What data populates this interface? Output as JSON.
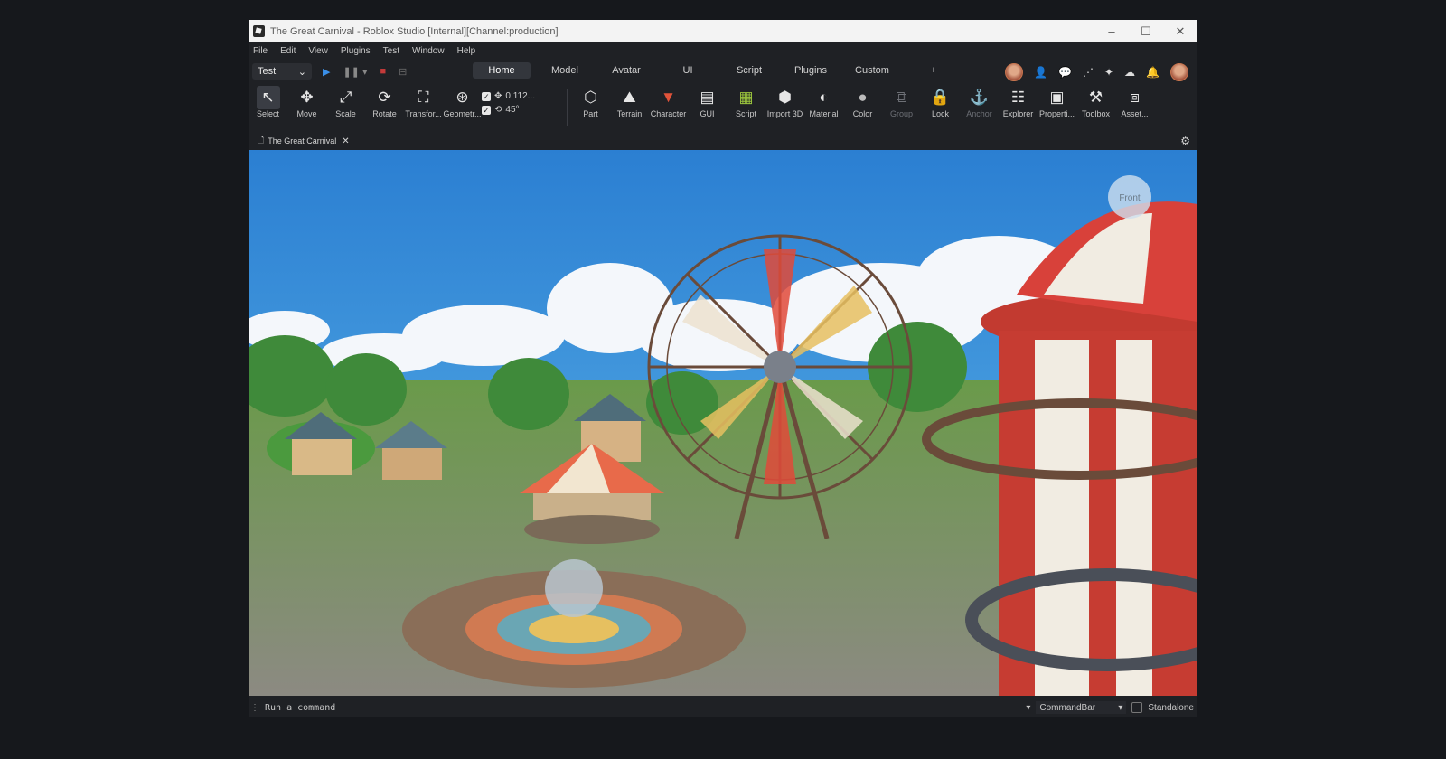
{
  "window": {
    "title": "The Great Carnival - Roblox Studio [Internal][Channel:production]"
  },
  "menu": [
    "File",
    "Edit",
    "View",
    "Plugins",
    "Test",
    "Window",
    "Help"
  ],
  "mode_select": {
    "value": "Test"
  },
  "tabs": [
    "Home",
    "Model",
    "Avatar",
    "UI",
    "Script",
    "Plugins",
    "Custom"
  ],
  "tabs_add": "+",
  "tools_left": [
    {
      "label": "Select",
      "icon": "select-icon"
    },
    {
      "label": "Move",
      "icon": "move-icon"
    },
    {
      "label": "Scale",
      "icon": "scale-icon"
    },
    {
      "label": "Rotate",
      "icon": "rotate-icon"
    },
    {
      "label": "Transfor...",
      "icon": "transform-icon"
    },
    {
      "label": "Geometr...",
      "icon": "geometry-icon"
    }
  ],
  "snap": {
    "move_value": "0.112...",
    "rotate_value": "45°"
  },
  "tools_right": [
    {
      "label": "Part",
      "icon": "part-icon"
    },
    {
      "label": "Terrain",
      "icon": "terrain-icon"
    },
    {
      "label": "Character",
      "icon": "character-icon"
    },
    {
      "label": "GUI",
      "icon": "gui-icon"
    },
    {
      "label": "Script",
      "icon": "script-icon"
    },
    {
      "label": "Import 3D",
      "icon": "import3d-icon"
    },
    {
      "label": "Material",
      "icon": "material-icon"
    },
    {
      "label": "Color",
      "icon": "color-icon"
    },
    {
      "label": "Group",
      "icon": "group-icon"
    },
    {
      "label": "Lock",
      "icon": "lock-icon"
    },
    {
      "label": "Anchor",
      "icon": "anchor-icon"
    },
    {
      "label": "Explorer",
      "icon": "explorer-icon"
    },
    {
      "label": "Properti...",
      "icon": "properties-icon"
    },
    {
      "label": "Toolbox",
      "icon": "toolbox-icon"
    },
    {
      "label": "Asset...",
      "icon": "asset-manager-icon"
    }
  ],
  "doc_tab": {
    "label": "The Great Carnival"
  },
  "viewport": {
    "view_cube_label": "Front"
  },
  "statusbar": {
    "command_placeholder": "Run a command",
    "command_select": "CommandBar",
    "standalone_label": "Standalone"
  }
}
